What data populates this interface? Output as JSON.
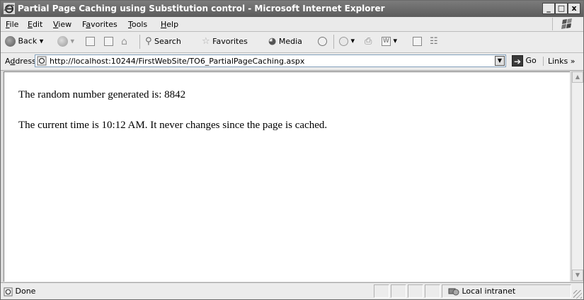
{
  "window": {
    "title": "Partial Page Caching using Substitution control - Microsoft Internet Explorer",
    "buttons": {
      "minimize": "_",
      "maximize": "□",
      "close": "x"
    }
  },
  "menu": {
    "items": [
      {
        "prefix": "",
        "key": "F",
        "rest": "ile"
      },
      {
        "prefix": "",
        "key": "E",
        "rest": "dit"
      },
      {
        "prefix": "",
        "key": "V",
        "rest": "iew"
      },
      {
        "prefix": "F",
        "key": "a",
        "rest": "vorites"
      },
      {
        "prefix": "",
        "key": "T",
        "rest": "ools"
      },
      {
        "prefix": "",
        "key": "H",
        "rest": "elp"
      }
    ]
  },
  "toolbar": {
    "back": "Back",
    "search": "Search",
    "favorites": "Favorites",
    "media": "Media"
  },
  "address": {
    "label_prefix": "A",
    "label_key": "d",
    "label_rest": "dress",
    "url": "http://localhost:10244/FirstWebSite/TO6_PartialPageCaching.aspx",
    "go": "Go",
    "links": "Links"
  },
  "content": {
    "line1": "The random number generated is: 8842",
    "line2": "The current time is 10:12 AM. It never changes since the page is cached."
  },
  "status": {
    "text": "Done",
    "zone": "Local intranet"
  },
  "colors": {
    "titlebar": "#6b6b6b",
    "chrome": "#ececec"
  }
}
